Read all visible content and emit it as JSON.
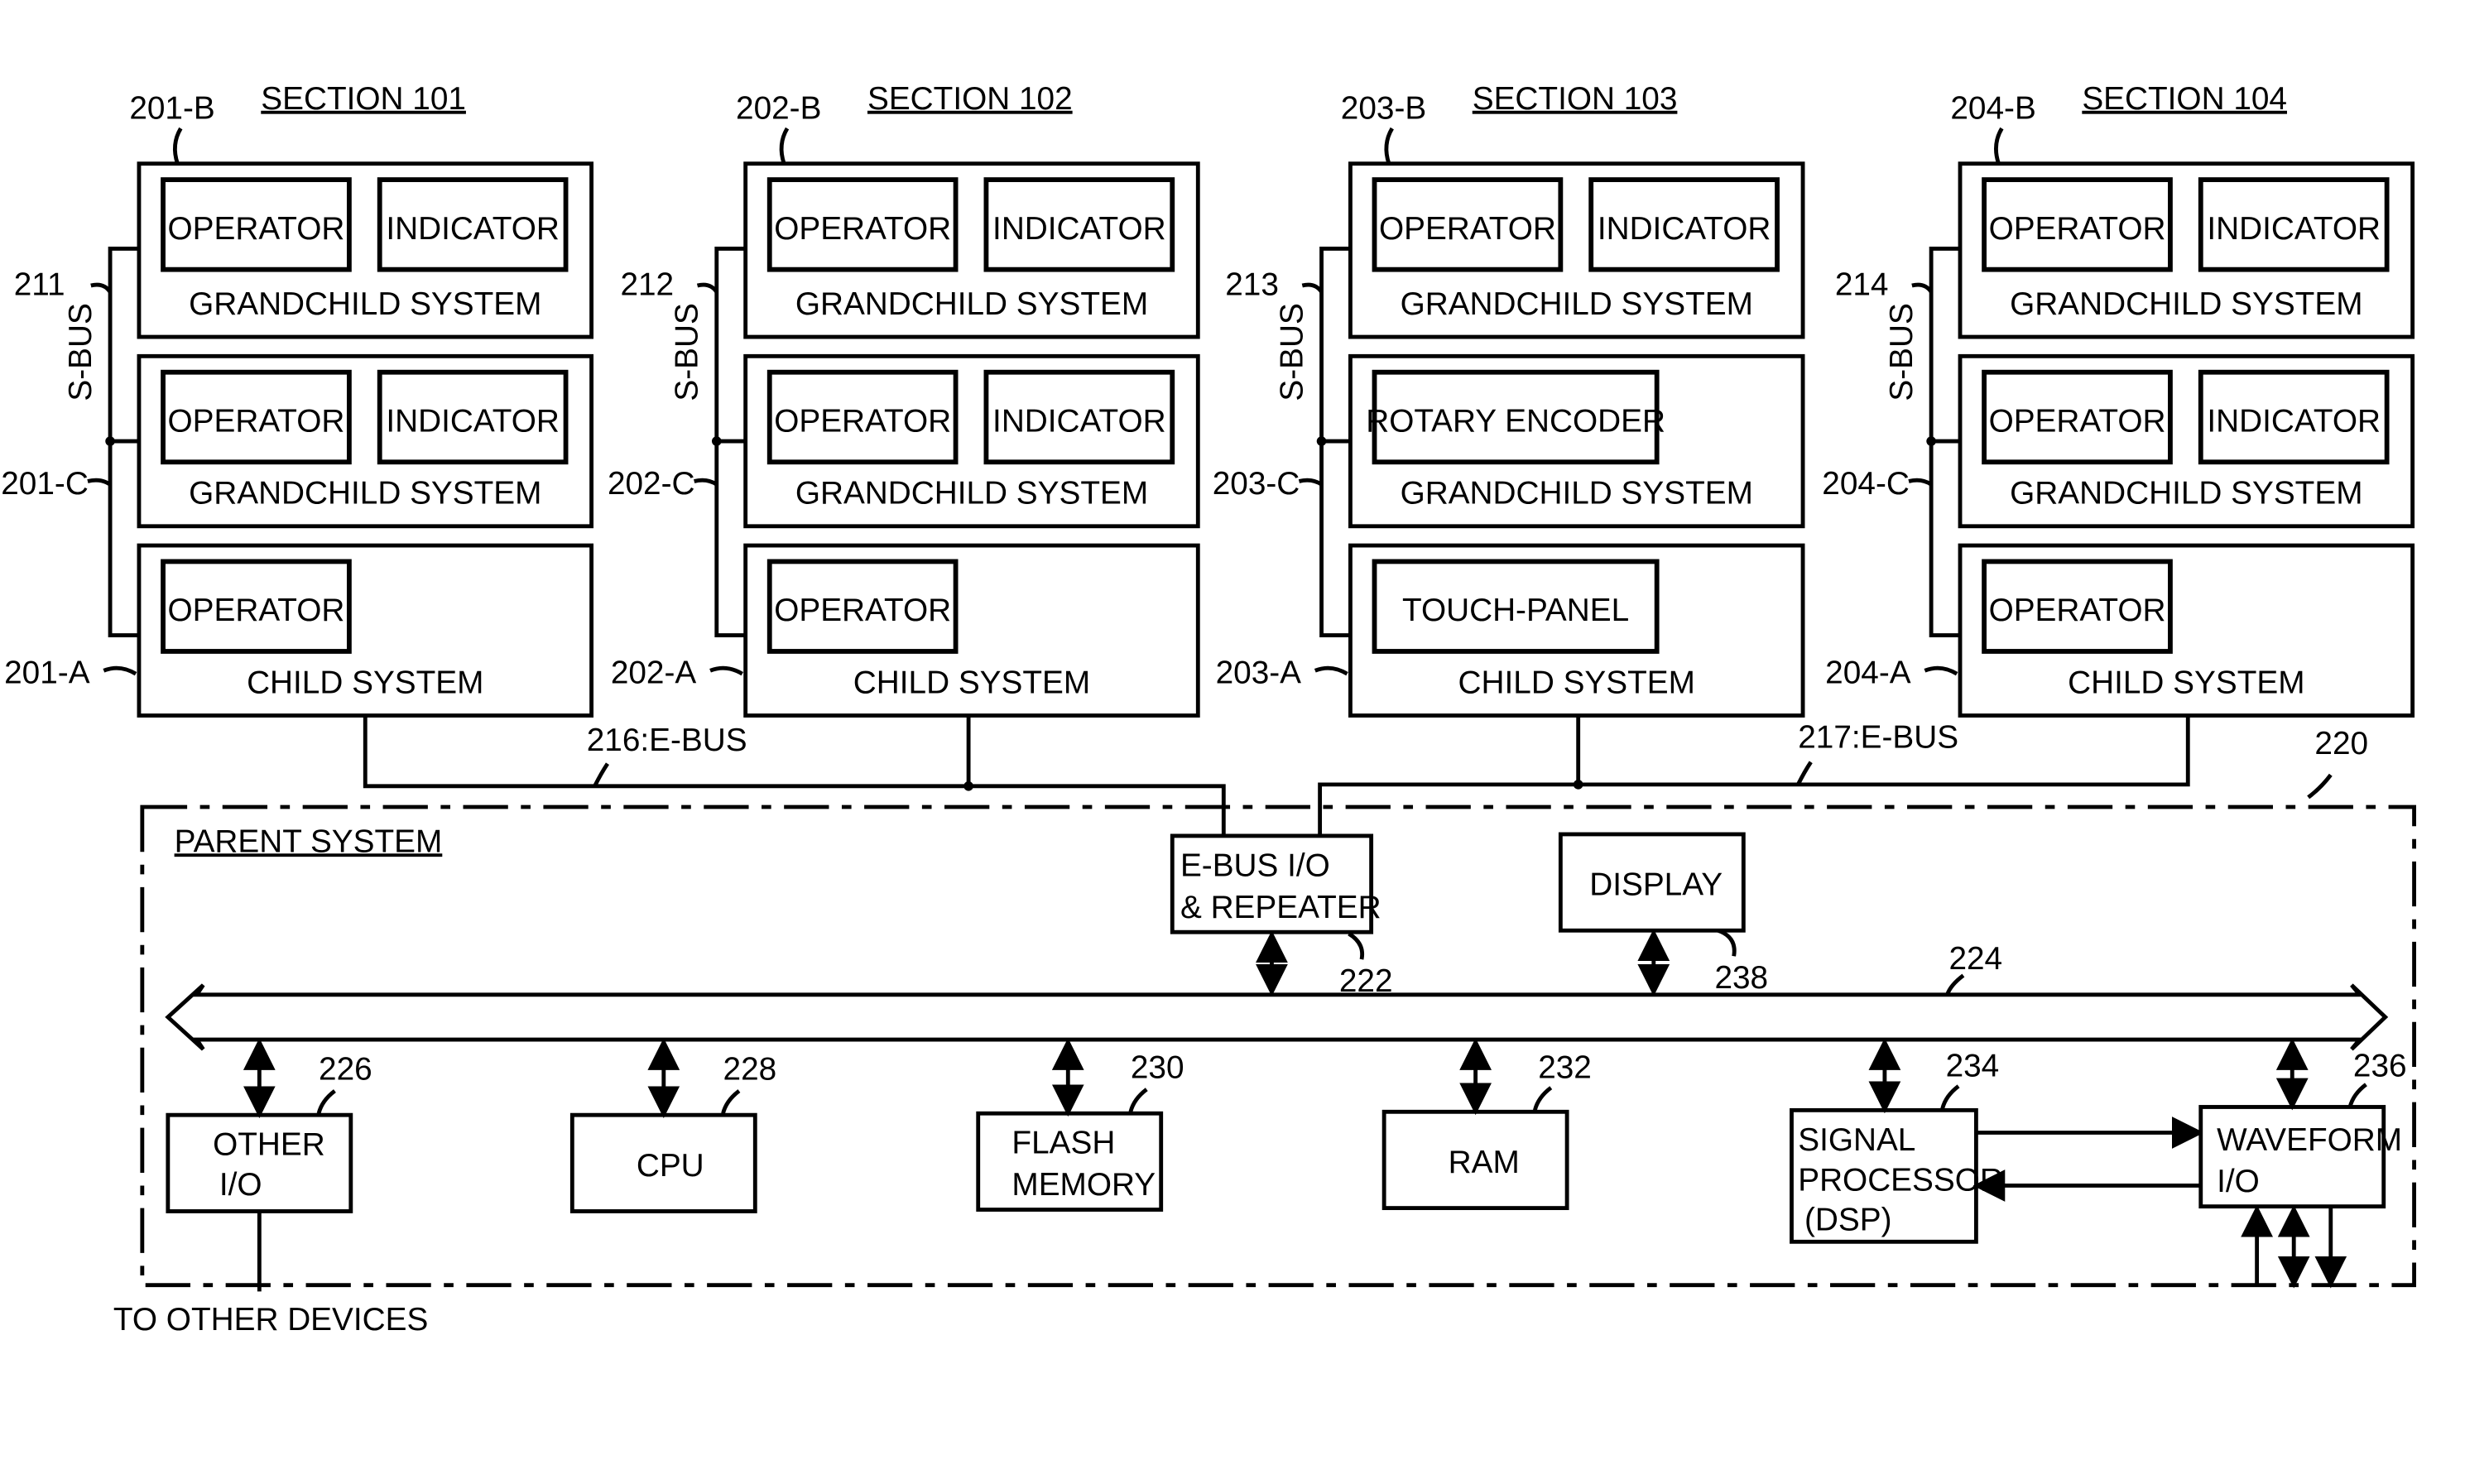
{
  "sections": [
    {
      "title": "SECTION 101",
      "ref_b": "201-B",
      "ref_c": "201-C",
      "ref_a": "201-A",
      "bus_ref": "211",
      "bus_label": "S-BUS",
      "grandchild1": {
        "items": [
          "OPERATOR",
          "INDICATOR"
        ],
        "label": "GRANDCHILD SYSTEM"
      },
      "grandchild2": {
        "items": [
          "OPERATOR",
          "INDICATOR"
        ],
        "label": "GRANDCHILD SYSTEM"
      },
      "child": {
        "items": [
          "OPERATOR"
        ],
        "label": "CHILD SYSTEM"
      }
    },
    {
      "title": "SECTION 102",
      "ref_b": "202-B",
      "ref_c": "202-C",
      "ref_a": "202-A",
      "bus_ref": "212",
      "bus_label": "S-BUS",
      "grandchild1": {
        "items": [
          "OPERATOR",
          "INDICATOR"
        ],
        "label": "GRANDCHILD SYSTEM"
      },
      "grandchild2": {
        "items": [
          "OPERATOR",
          "INDICATOR"
        ],
        "label": "GRANDCHILD SYSTEM"
      },
      "child": {
        "items": [
          "OPERATOR"
        ],
        "label": "CHILD SYSTEM"
      }
    },
    {
      "title": "SECTION 103",
      "ref_b": "203-B",
      "ref_c": "203-C",
      "ref_a": "203-A",
      "bus_ref": "213",
      "bus_label": "S-BUS",
      "grandchild1": {
        "items": [
          "OPERATOR",
          "INDICATOR"
        ],
        "label": "GRANDCHILD SYSTEM"
      },
      "grandchild2": {
        "items": [
          "ROTARY ENCODER"
        ],
        "label": "GRANDCHILD SYSTEM"
      },
      "child": {
        "items": [
          "TOUCH-PANEL"
        ],
        "label": "CHILD SYSTEM"
      }
    },
    {
      "title": "SECTION 104",
      "ref_b": "204-B",
      "ref_c": "204-C",
      "ref_a": "204-A",
      "bus_ref": "214",
      "bus_label": "S-BUS",
      "grandchild1": {
        "items": [
          "OPERATOR",
          "INDICATOR"
        ],
        "label": "GRANDCHILD SYSTEM"
      },
      "grandchild2": {
        "items": [
          "OPERATOR",
          "INDICATOR"
        ],
        "label": "GRANDCHILD SYSTEM"
      },
      "child": {
        "items": [
          "OPERATOR"
        ],
        "label": "CHILD SYSTEM"
      }
    }
  ],
  "ebus": {
    "left": "216:E-BUS",
    "right": "217:E-BUS"
  },
  "parent": {
    "title": "PARENT SYSTEM",
    "ref": "220",
    "bus_ref": "224",
    "ebus_io": {
      "line1": "E-BUS I/O",
      "line2": "& REPEATER",
      "ref": "222"
    },
    "display": {
      "label": "DISPLAY",
      "ref": "238"
    },
    "other_io": {
      "line1": "OTHER",
      "line2": "I/O",
      "ref": "226"
    },
    "cpu": {
      "label": "CPU",
      "ref": "228"
    },
    "flash": {
      "line1": "FLASH",
      "line2": "MEMORY",
      "ref": "230"
    },
    "ram": {
      "label": "RAM",
      "ref": "232"
    },
    "dsp": {
      "line1": "SIGNAL",
      "line2": "PROCESSOR",
      "line3": "(DSP)",
      "ref": "234"
    },
    "waveform": {
      "line1": "WAVEFORM",
      "line2": "I/O",
      "ref": "236"
    },
    "to_other": "TO OTHER DEVICES"
  }
}
